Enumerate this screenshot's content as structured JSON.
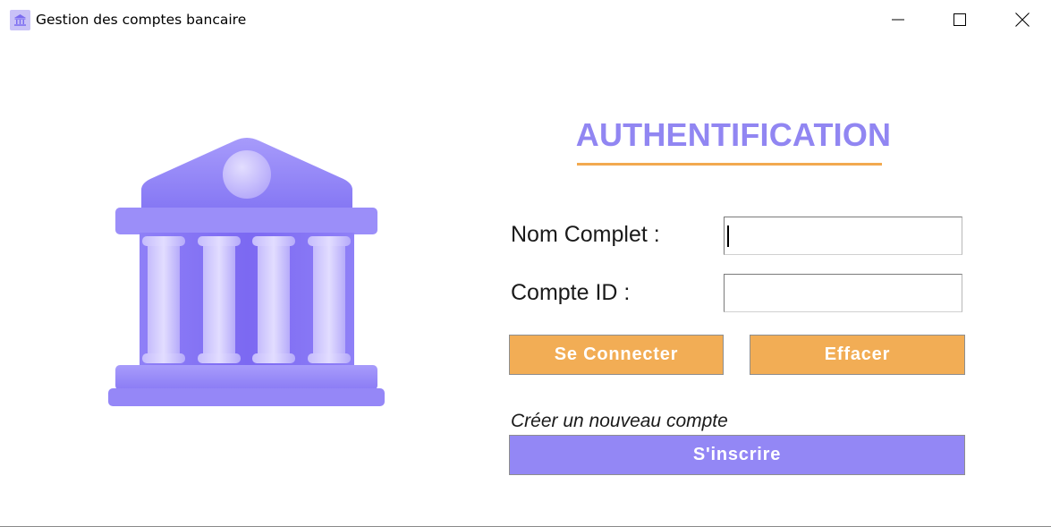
{
  "window": {
    "title": "Gestion des comptes bancaire",
    "icon": "bank-icon",
    "controls": {
      "minimize_icon": "minimize-icon",
      "maximize_icon": "maximize-icon",
      "close_icon": "close-icon"
    }
  },
  "illustration": {
    "icon": "bank-building-icon",
    "color": "#8b7cf6"
  },
  "auth": {
    "title": "AUTHENTIFICATION",
    "title_color": "#9186f2",
    "underline_color": "#f2a94f",
    "fields": {
      "nom_label": "Nom Complet :",
      "nom_value": "",
      "nom_placeholder": "",
      "id_label": "Compte ID :",
      "id_value": "",
      "id_placeholder": ""
    },
    "buttons": {
      "connect": "Se Connecter",
      "clear": "Effacer",
      "accent": "#f2ad55"
    },
    "create_account_label": "Créer un nouveau compte",
    "signup_button": "S'inscrire",
    "signup_color": "#9387f5"
  }
}
